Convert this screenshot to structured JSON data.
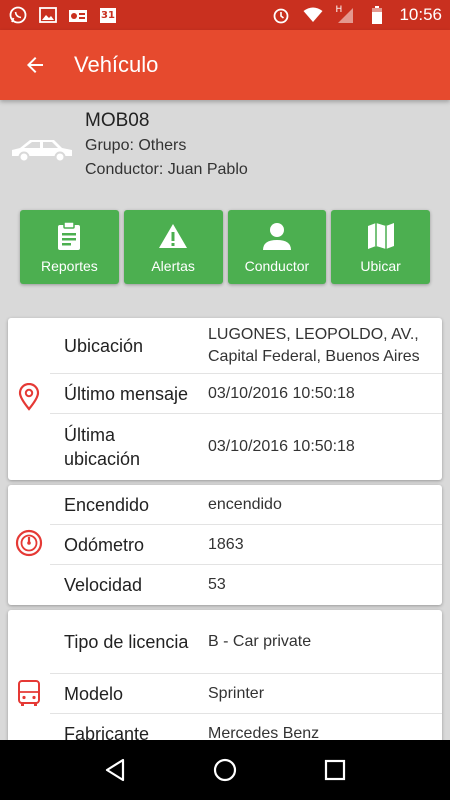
{
  "status_bar": {
    "time": "10:56",
    "calendar_day": "31",
    "icons": [
      "whatsapp-icon",
      "image-icon",
      "radio-icon",
      "calendar-icon",
      "alarm-icon",
      "wifi-icon",
      "h-signal-icon",
      "battery-icon"
    ],
    "h_label": "H"
  },
  "app_bar": {
    "title": "Vehículo"
  },
  "vehicle": {
    "code": "MOB08",
    "group": "Grupo: Others",
    "driver": "Conductor: Juan Pablo"
  },
  "actions": [
    {
      "label": "Reportes",
      "icon": "clipboard-icon"
    },
    {
      "label": "Alertas",
      "icon": "warning-icon"
    },
    {
      "label": "Conductor",
      "icon": "person-icon"
    },
    {
      "label": "Ubicar",
      "icon": "map-icon"
    }
  ],
  "location_card": {
    "icon": "location-pin-icon",
    "rows": [
      {
        "label": "Ubicación",
        "value": "LUGONES, LEOPOLDO, AV., Capital Federal, Buenos Aires"
      },
      {
        "label": "Último mensaje",
        "value": "03/10/2016 10:50:18"
      },
      {
        "label": "Última ubicación",
        "value": "03/10/2016 10:50:18"
      }
    ]
  },
  "telemetry_card": {
    "icon": "speedometer-icon",
    "rows": [
      {
        "label": "Encendido",
        "value": "encendido"
      },
      {
        "label": "Odómetro",
        "value": "1863"
      },
      {
        "label": "Velocidad",
        "value": "53"
      }
    ]
  },
  "info_card": {
    "icon": "bus-icon",
    "rows": [
      {
        "label": "Tipo de licencia",
        "value": "B - Car private"
      },
      {
        "label": "Modelo",
        "value": "Sprinter"
      },
      {
        "label": "Fabricante",
        "value": "Mercedes Benz"
      }
    ]
  },
  "colors": {
    "status_bar": "#c9301f",
    "app_bar": "#e64a2e",
    "action_green": "#4caf50",
    "icon_red": "#e53935",
    "background": "#d9d9d9"
  }
}
